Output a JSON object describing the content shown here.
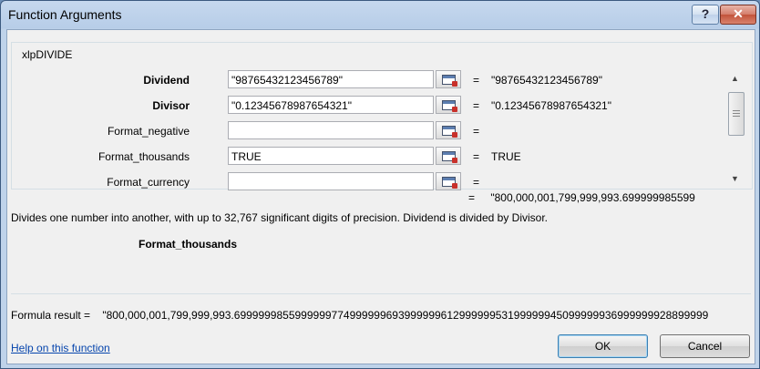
{
  "window": {
    "title": "Function Arguments",
    "help_button": "?",
    "close_button": "✕"
  },
  "group": {
    "label": "xlpDIVIDE",
    "args": [
      {
        "name": "Dividend",
        "bold": true,
        "value": "\"98765432123456789\"",
        "result": "\"98765432123456789\""
      },
      {
        "name": "Divisor",
        "bold": true,
        "value": "\"0.12345678987654321\"",
        "result": "\"0.12345678987654321\""
      },
      {
        "name": "Format_negative",
        "bold": false,
        "value": "",
        "result": ""
      },
      {
        "name": "Format_thousands",
        "bold": false,
        "value": "TRUE",
        "result": "TRUE"
      },
      {
        "name": "Format_currency",
        "bold": false,
        "value": "",
        "result": ""
      }
    ],
    "scrollbar": {
      "up_icon": "▲",
      "down_icon": "▼"
    }
  },
  "equals_sign": "=",
  "function_result": "\"800,000,001,799,999,993.699999985599",
  "description": "Divides one number into another, with up to 32,767 significant digits of precision. Dividend is divided by Divisor.",
  "current_argument": "Format_thousands",
  "formula_result": {
    "label": "Formula result =",
    "value": "\"800,000,001,799,999,993.699999985599999977499999969399999961299999953199999945099999936999999928899999"
  },
  "help_link": "Help on this function",
  "buttons": {
    "ok": "OK",
    "cancel": "Cancel"
  }
}
